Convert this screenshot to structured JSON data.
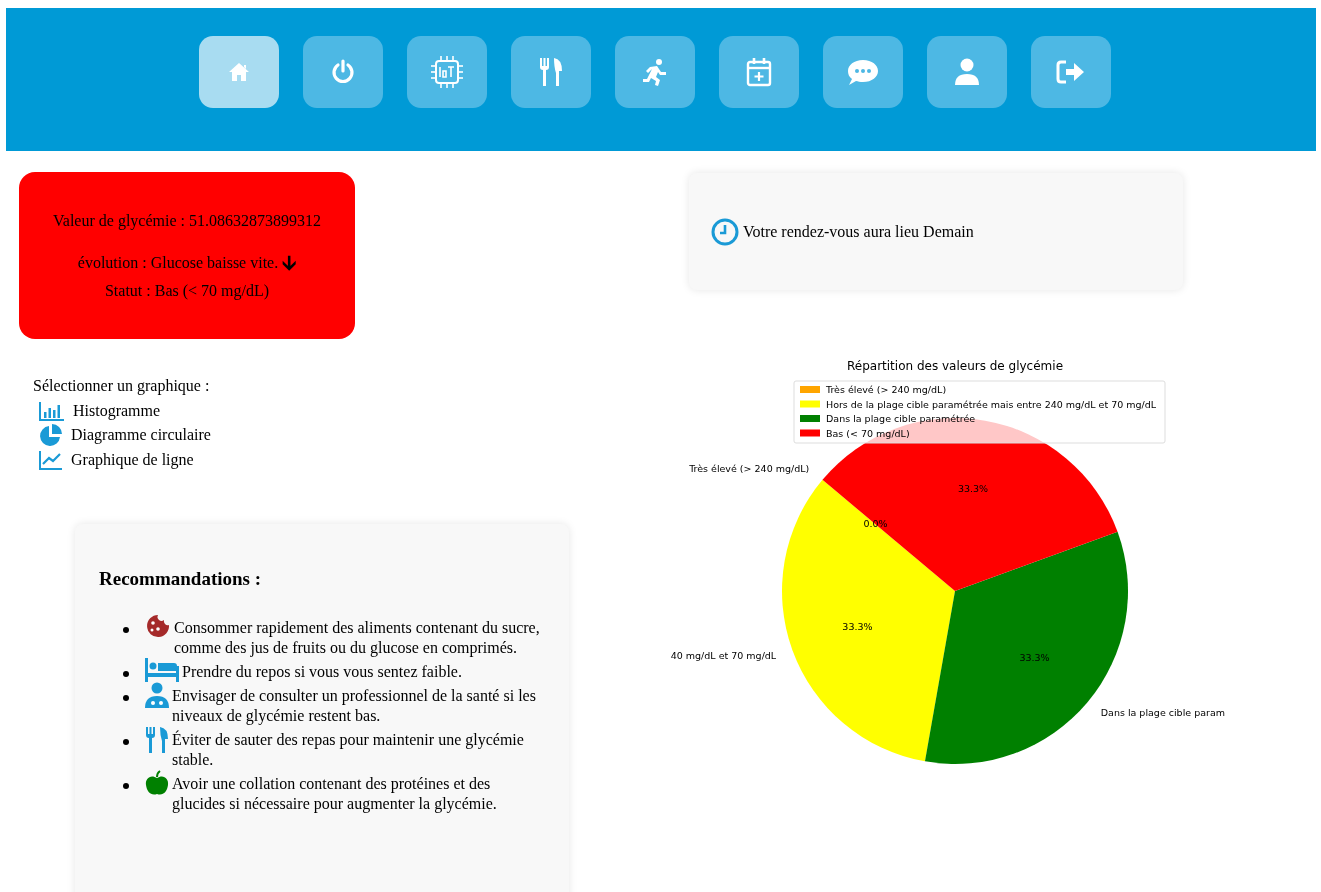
{
  "nav": [
    {
      "kind": "home",
      "selected": true
    },
    {
      "kind": "power",
      "selected": false
    },
    {
      "kind": "iot",
      "selected": false
    },
    {
      "kind": "food",
      "selected": false
    },
    {
      "kind": "run",
      "selected": false
    },
    {
      "kind": "calendar",
      "selected": false
    },
    {
      "kind": "chat",
      "selected": false
    },
    {
      "kind": "user",
      "selected": false
    },
    {
      "kind": "logout",
      "selected": false
    }
  ],
  "glucose": {
    "value": "Valeur de glycémie : 51.08632873899312",
    "evolution": "évolution : Glucose baisse vite.",
    "trend_arrow": "🡫",
    "status": "Statut : Bas (< 70 mg/dL)"
  },
  "chart_picker": {
    "label": "Sélectionner un graphique :",
    "options": [
      {
        "kind": "bar",
        "label": "Histogramme"
      },
      {
        "kind": "pie",
        "label": "Diagramme circulaire"
      },
      {
        "kind": "line",
        "label": "Graphique de ligne"
      }
    ]
  },
  "appointment": {
    "text": "Votre rendez-vous aura lieu Demain"
  },
  "recommendations": {
    "title": "Recommandations :",
    "items": [
      {
        "kind": "cookie",
        "text": "Consommer rapidement des aliments contenant du sucre, comme des jus de fruits ou du glucose en comprimés."
      },
      {
        "kind": "bed",
        "text": "Prendre du repos si vous vous sentez faible."
      },
      {
        "kind": "doctor",
        "text": "Envisager de consulter un professionnel de la santé si les niveaux de glycémie restent bas."
      },
      {
        "kind": "food",
        "text": "Éviter de sauter des repas pour maintenir une glycémie stable."
      },
      {
        "kind": "apple",
        "text": "Avoir une collation contenant des protéines et des glucides si nécessaire pour augmenter la glycémie."
      }
    ]
  },
  "chart": {
    "chart_data": {
      "type": "pie",
      "title": "Répartition des valeurs de glycémie",
      "categories": [
        "Très élevé (> 240 mg/dL)",
        "Hors de la plage cible paramétrée mais entre 240 mg/dL et 70 mg/dL",
        "Dans la plage cible paramétrée",
        "Bas (< 70 mg/dL)"
      ],
      "values": [
        0,
        33.3,
        33.3,
        33.3
      ],
      "colors": [
        "#ffa500",
        "#ffff00",
        "#008000",
        "#ff0000"
      ],
      "value_labels": [
        "0.0%",
        "33.3%",
        "33.3%",
        "33.3%"
      ],
      "legend": true,
      "annotations": [
        "Très élevé (> 240 mg/dL)",
        "40 mg/dL et 70 mg/dL",
        "Dans la plage cible param"
      ]
    }
  }
}
